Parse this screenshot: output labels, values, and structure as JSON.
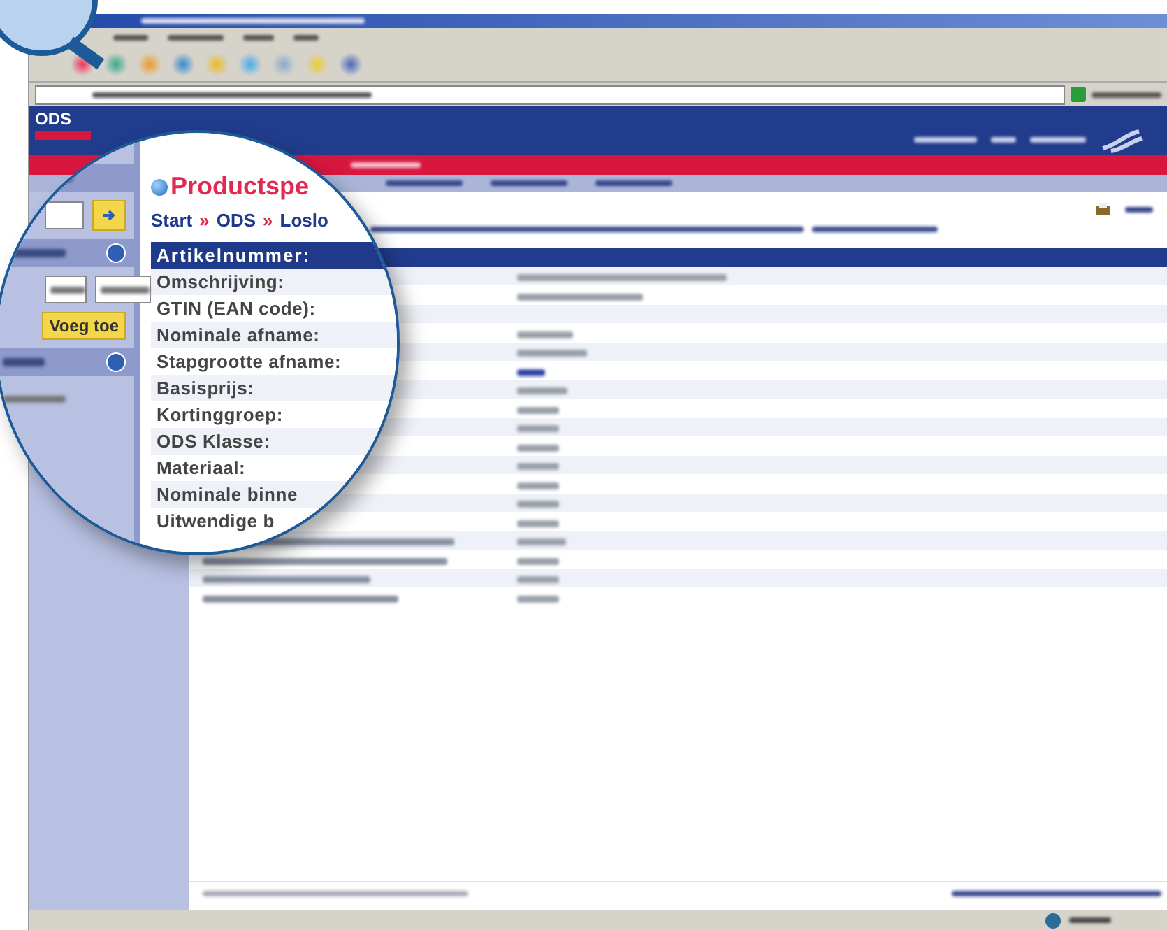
{
  "site_header": {
    "logo": "ODS"
  },
  "magnifier": {
    "page_title": "Productspe",
    "breadcrumb": [
      "Start",
      "ODS",
      "Loslo"
    ],
    "breadcrumb_separators": [
      "»",
      "»"
    ],
    "sidebar_button": "Voeg toe",
    "labels": [
      {
        "text": "Artikelnummer:",
        "kind": "header"
      },
      {
        "text": "Omschrijving:",
        "kind": "row"
      },
      {
        "text": "GTIN (EAN code):",
        "kind": "row"
      },
      {
        "text": "Nominale afname:",
        "kind": "row"
      },
      {
        "text": "Stapgrootte afname:",
        "kind": "row"
      },
      {
        "text": "Basisprijs:",
        "kind": "row"
      },
      {
        "text": "Kortinggroep:",
        "kind": "row"
      },
      {
        "text": "ODS Klasse:",
        "kind": "row"
      },
      {
        "text": "Materiaal:",
        "kind": "row"
      },
      {
        "text": "Nominale binne",
        "kind": "row"
      },
      {
        "text": "Uitwendige b",
        "kind": "row"
      }
    ]
  }
}
